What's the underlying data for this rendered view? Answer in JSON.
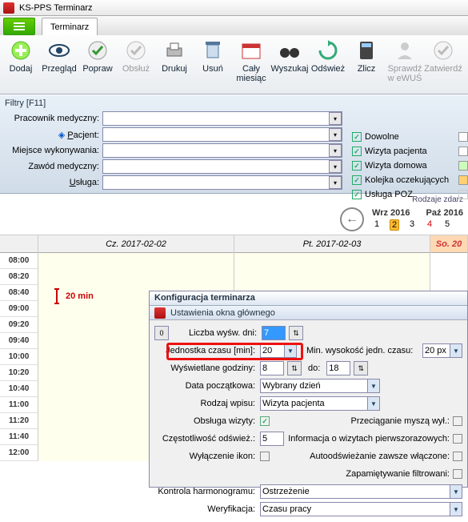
{
  "window": {
    "title": "KS-PPS Terminarz"
  },
  "tab": {
    "label": "Terminarz"
  },
  "toolbar": {
    "dodaj": "Dodaj",
    "przeglad": "Przegląd",
    "popraw": "Popraw",
    "obsluz": "Obsłuż",
    "drukuj": "Drukuj",
    "usun": "Usuń",
    "caly_miesiac": "Cały miesiąc",
    "wyszukaj": "Wyszukaj",
    "odswiez": "Odśwież",
    "zlicz": "Zlicz",
    "sprawdz": "Sprawdź w eWUŚ",
    "zatwierdz": "Zatwierdź"
  },
  "filters": {
    "header": "Filtry [F11]",
    "pracownik": "Pracownik medyczny:",
    "pacjent": "Pacjent:",
    "miejsce": "Miejsce wykonywania:",
    "zawod": "Zawód medyczny:",
    "usluga": "Usługa:"
  },
  "legend": {
    "dowolne": "Dowolne",
    "wizyta_pacjenta": "Wizyta pacjenta",
    "wizyta_domowa": "Wizyta domowa",
    "kolejka": "Kolejka oczekujących",
    "usluga_poz": "Usługa POZ",
    "rodzaje": "Rodzaje zdarz"
  },
  "colors": {
    "dowolne": "#ffffff",
    "wizyta_pacjenta": "#ffffff",
    "wizyta_domowa": "#ccffcc",
    "kolejka": "#ffd070",
    "usluga_poz": "#ffffff"
  },
  "nav": {
    "m1": "Wrz 2016",
    "m2": "Paź 2016",
    "nums": [
      "1",
      "2",
      "3",
      "4",
      "5"
    ],
    "current_idx": 1
  },
  "schedule": {
    "day1": "Cz. 2017-02-02",
    "day2": "Pt. 2017-02-03",
    "day3": "So. 20",
    "times": [
      "08:00",
      "08:20",
      "08:40",
      "09:00",
      "09:20",
      "09:40",
      "10:00",
      "10:20",
      "10:40",
      "11:00",
      "11:20",
      "11:40",
      "12:00"
    ],
    "hint": "20 min"
  },
  "config": {
    "title": "Konfiguracja terminarza",
    "group": "Ustawienia okna głównego",
    "zero_btn": "0",
    "liczba_dni_lab": "Liczba wyśw. dni:",
    "liczba_dni_val": "7",
    "jednostka_lab": "Jednostka czasu [min]:",
    "jednostka_val": "20",
    "min_wys_lab": "Min. wysokość jedn. czasu:",
    "min_wys_val": "20 px",
    "wys_godz_lab": "Wyświetlane godziny:",
    "wys_godz_from": "8",
    "do": "do:",
    "wys_godz_to": "18",
    "data_pocz_lab": "Data początkowa:",
    "data_pocz_val": "Wybrany dzień",
    "rodzaj_lab": "Rodzaj wpisu:",
    "rodzaj_val": "Wizyta pacjenta",
    "obsluga_lab": "Obsługa wizyty:",
    "przeciaganie_lab": "Przeciąganie myszą wył.:",
    "czest_lab": "Częstotliwość odśwież.:",
    "czest_val": "5",
    "info_lab": "Informacja o wizytach pierwszorazowych:",
    "wyl_ikon_lab": "Wyłączenie ikon:",
    "auto_lab": "Autoodświeżanie zawsze włączone:",
    "zapam_lab": "Zapamiętywanie filtrowani:",
    "kontrola_lab": "Kontrola harmonogramu:",
    "kontrola_val": "Ostrzeżenie",
    "weryf_lab": "Weryfikacja:",
    "weryf_val": "Czasu pracy"
  }
}
